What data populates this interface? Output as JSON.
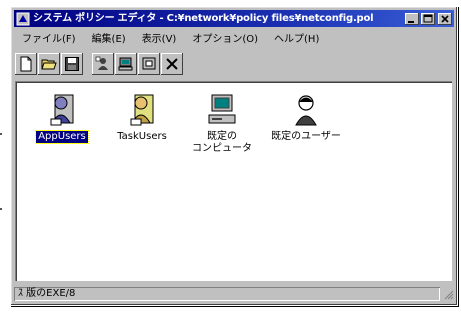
{
  "window": {
    "title": "システム ポリシー エディタ - C:¥network¥policy files¥netconfig.pol"
  },
  "menu": {
    "items": [
      {
        "label": "ファイル(F)"
      },
      {
        "label": "編集(E)"
      },
      {
        "label": "表示(V)"
      },
      {
        "label": "オプション(O)"
      },
      {
        "label": "ヘルプ(H)"
      }
    ]
  },
  "toolbar": {
    "buttons": [
      {
        "icon": "new-document-icon"
      },
      {
        "icon": "open-folder-icon"
      },
      {
        "icon": "save-floppy-icon"
      },
      {
        "icon": "add-user-icon"
      },
      {
        "icon": "add-computer-icon"
      },
      {
        "icon": "add-group-icon"
      },
      {
        "icon": "remove-icon"
      }
    ]
  },
  "items": [
    {
      "label": "AppUsers",
      "icon": "user-group-icon",
      "selected": true
    },
    {
      "label": "TaskUsers",
      "icon": "user-group-icon",
      "selected": false
    },
    {
      "label": "既定の\nコンピュータ",
      "icon": "computer-icon",
      "selected": false
    },
    {
      "label": "既定のユーザー",
      "icon": "user-icon",
      "selected": false
    }
  ],
  "statusbar": {
    "text": "ｽ 版のEXE/8"
  },
  "colors": {
    "titlebar": "#000080",
    "face": "#c0c0c0",
    "selection": "#000080"
  }
}
